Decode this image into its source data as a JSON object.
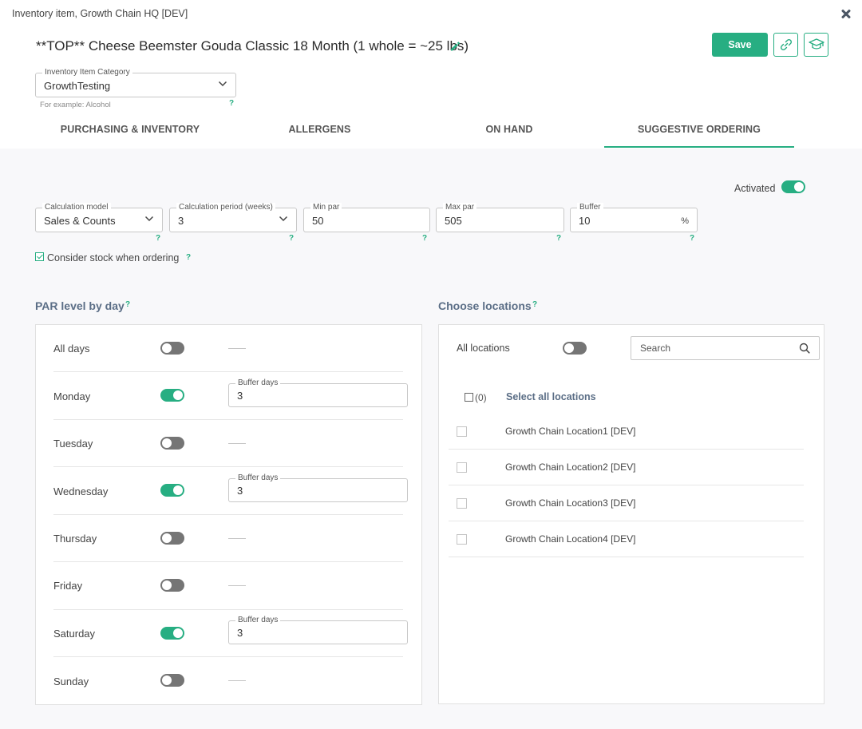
{
  "modal": {
    "title": "Inventory item, Growth Chain HQ [DEV]"
  },
  "item": {
    "name": "**TOP** Cheese Beemster Gouda Classic 18 Month (1 whole = ~25 lbs)"
  },
  "header": {
    "save_label": "Save",
    "link_icon": "link-icon",
    "tutorial_icon": "graduation-cap-icon"
  },
  "category": {
    "label": "Inventory Item Category",
    "value": "GrowthTesting",
    "hint": "For example: Alcohol",
    "help": "?"
  },
  "tabs": [
    {
      "label": "PURCHASING & INVENTORY",
      "active": false
    },
    {
      "label": "ALLERGENS",
      "active": false
    },
    {
      "label": "ON HAND",
      "active": false
    },
    {
      "label": "SUGGESTIVE ORDERING",
      "active": true
    }
  ],
  "activated": {
    "label": "Activated",
    "on": true
  },
  "settings": {
    "calc_model": {
      "label": "Calculation model",
      "value": "Sales & Counts"
    },
    "calc_period": {
      "label": "Calculation period (weeks)",
      "value": "3"
    },
    "min_par": {
      "label": "Min par",
      "value": "50"
    },
    "max_par": {
      "label": "Max par",
      "value": "505"
    },
    "buffer": {
      "label": "Buffer",
      "value": "10",
      "suffix": "%"
    },
    "help": "?"
  },
  "consider_stock": {
    "label": "Consider stock when ordering",
    "checked": true,
    "help": "?"
  },
  "par": {
    "title": "PAR level by day",
    "help": "?",
    "buffer_label": "Buffer days",
    "days": [
      {
        "label": "All days",
        "on": false,
        "buffer": null
      },
      {
        "label": "Monday",
        "on": true,
        "buffer": "3"
      },
      {
        "label": "Tuesday",
        "on": false,
        "buffer": null
      },
      {
        "label": "Wednesday",
        "on": true,
        "buffer": "3"
      },
      {
        "label": "Thursday",
        "on": false,
        "buffer": null
      },
      {
        "label": "Friday",
        "on": false,
        "buffer": null
      },
      {
        "label": "Saturday",
        "on": true,
        "buffer": "3"
      },
      {
        "label": "Sunday",
        "on": false,
        "buffer": null
      }
    ]
  },
  "locations": {
    "title": "Choose locations",
    "help": "?",
    "all_label": "All locations",
    "all_on": false,
    "search_placeholder": "Search",
    "select_count": "(0)",
    "select_all_label": "Select all locations",
    "items": [
      {
        "label": "Growth Chain Location1 [DEV]",
        "checked": false
      },
      {
        "label": "Growth Chain Location2 [DEV]",
        "checked": false
      },
      {
        "label": "Growth Chain Location3 [DEV]",
        "checked": false
      },
      {
        "label": "Growth Chain Location4 [DEV]",
        "checked": false
      }
    ]
  },
  "colors": {
    "accent": "#27ae82",
    "section_title": "#5b6e86",
    "toggle_off": "#757575"
  }
}
